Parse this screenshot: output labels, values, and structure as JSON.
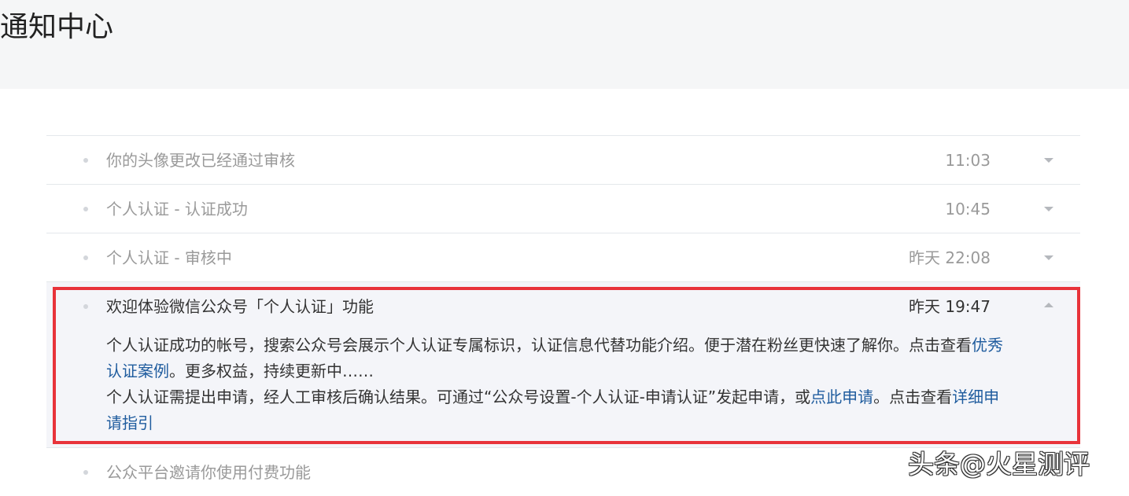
{
  "page": {
    "title": "通知中心"
  },
  "notifications": [
    {
      "title": "你的头像更改已经通过审核",
      "time": "11:03"
    },
    {
      "title": "个人认证 - 认证成功",
      "time": "10:45"
    },
    {
      "title": "个人认证 - 审核中",
      "time": "昨天 22:08"
    },
    {
      "title": "欢迎体验微信公众号「个人认证」功能",
      "time": "昨天 19:47",
      "body": {
        "p1_text": "个人认证成功的帐号，搜索公众号会展示个人认证专属标识，认证信息代替功能介绍。便于潜在粉丝更快速了解你。点击查看",
        "p1_link": "优秀认证案例",
        "p1_tail": "。更多权益，持续更新中……",
        "p2_text": "个人认证需提出申请，经人工审核后确认结果。可通过“公众号设置-个人认证-申请认证”发起申请，或",
        "p2_link1": "点此申请",
        "p2_mid": "。点击查看",
        "p2_link2": "详细申请指引"
      }
    },
    {
      "title": "公众平台邀请你使用付费功能"
    }
  ],
  "watermark": "头条@火星测评",
  "colors": {
    "highlight": "#e8333a",
    "link": "#1f5c9e",
    "expanded_bg": "#f4f5f9"
  }
}
